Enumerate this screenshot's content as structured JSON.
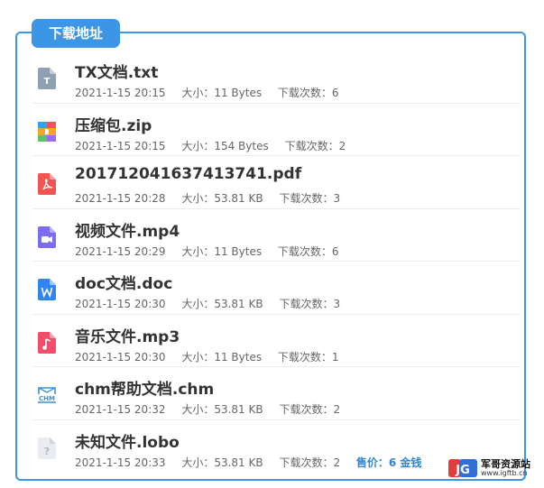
{
  "panel": {
    "title": "下载地址"
  },
  "files": [
    {
      "name": "TX文档.txt",
      "date": "2021-1-15 20:15",
      "size": "大小：11 Bytes",
      "downloads": "下载次数：6",
      "icon": "txt-file-icon",
      "color": "#8fa0b3"
    },
    {
      "name": "压缩包.zip",
      "date": "2021-1-15 20:15",
      "size": "大小：154 Bytes",
      "downloads": "下载次数：2",
      "icon": "zip-file-icon",
      "color": "#f5a623"
    },
    {
      "name": "201712041637413741.pdf",
      "date": "2021-1-15 20:28",
      "size": "大小：53.81 KB",
      "downloads": "下载次数：3",
      "icon": "pdf-file-icon",
      "color": "#f25353"
    },
    {
      "name": "视频文件.mp4",
      "date": "2021-1-15 20:29",
      "size": "大小：11 Bytes",
      "downloads": "下载次数：6",
      "icon": "video-file-icon",
      "color": "#7b6cf2"
    },
    {
      "name": "doc文档.doc",
      "date": "2021-1-15 20:30",
      "size": "大小：53.81 KB",
      "downloads": "下载次数：3",
      "icon": "word-file-icon",
      "color": "#2f86f2"
    },
    {
      "name": "音乐文件.mp3",
      "date": "2021-1-15 20:30",
      "size": "大小：11 Bytes",
      "downloads": "下载次数：1",
      "icon": "music-file-icon",
      "color": "#f24d6a"
    },
    {
      "name": "chm帮助文档.chm",
      "date": "2021-1-15 20:32",
      "size": "大小：53.81 KB",
      "downloads": "下载次数：2",
      "icon": "chm-file-icon",
      "color": "#3d8fe0"
    },
    {
      "name": "未知文件.lobo",
      "date": "2021-1-15 20:33",
      "size": "大小：53.81 KB",
      "downloads": "下载次数：2",
      "icon": "unknown-file-icon",
      "color": "#c9ced6",
      "price": "售价：6 金钱"
    }
  ],
  "watermark": {
    "title": "军哥资源站",
    "url": "www.igftb.cn",
    "logo_text": "JG"
  }
}
